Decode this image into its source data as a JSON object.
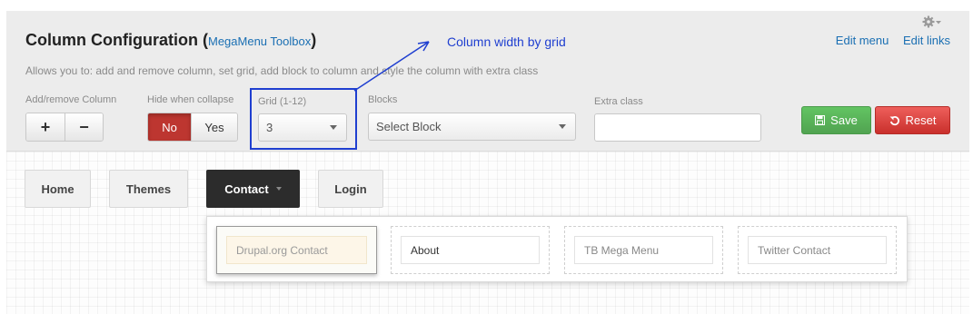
{
  "header": {
    "title": "Column Configuration",
    "title_open": "(",
    "title_close": ")",
    "subtitle_link": "MegaMenu Toolbox",
    "description": "Allows you to: add and remove column, set grid, add block to column and style the column with extra class",
    "edit_menu": "Edit menu",
    "edit_links": "Edit links",
    "settings_icon": "gear-icon"
  },
  "controls": {
    "add_remove_label": "Add/remove Column",
    "add_symbol": "+",
    "remove_symbol": "−",
    "hide_label": "Hide when collapse",
    "hide_no": "No",
    "hide_yes": "Yes",
    "grid_label": "Grid (1-12)",
    "grid_value": "3",
    "blocks_label": "Blocks",
    "blocks_placeholder": "Select Block",
    "extra_class_label": "Extra class",
    "extra_class_value": "",
    "save_label": "Save",
    "reset_label": "Reset"
  },
  "annotation": {
    "text": "Column width by grid",
    "color": "#1f3fd0"
  },
  "nav": {
    "items": [
      {
        "label": "Home"
      },
      {
        "label": "Themes"
      },
      {
        "label": "Contact"
      },
      {
        "label": "Login"
      }
    ],
    "active": "Contact"
  },
  "dropdown": {
    "columns": [
      {
        "block": "Drupal.org Contact",
        "selected": true
      },
      {
        "block": "About",
        "selected": false
      },
      {
        "block": "TB Mega Menu",
        "selected": false
      },
      {
        "block": "Twitter Contact",
        "selected": false
      }
    ]
  },
  "colors": {
    "save": "#51a351",
    "reset": "#c9302c",
    "hide_active": "#bd3630",
    "link": "#1a6fb3"
  }
}
